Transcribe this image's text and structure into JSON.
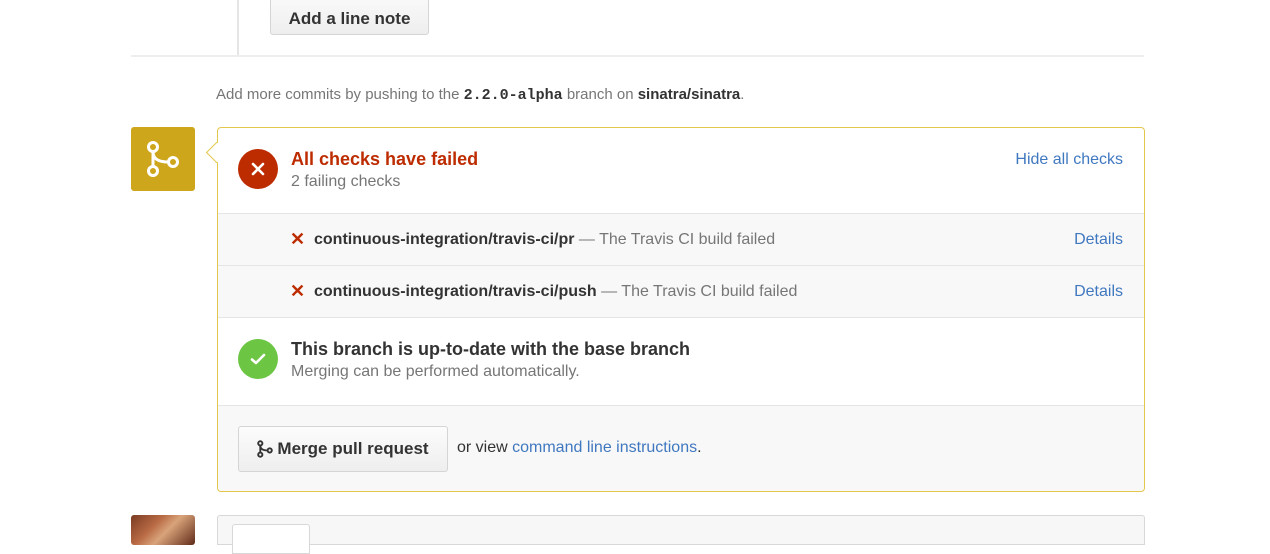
{
  "line_note": {
    "button_label": "Add a line note"
  },
  "push_note": {
    "prefix": "Add more commits by pushing to the ",
    "branch": "2.2.0-alpha",
    "middle": " branch on ",
    "repo": "sinatra/sinatra",
    "suffix": "."
  },
  "colors": {
    "warning_accent": "#cea61b",
    "fail_red": "#bd2c00",
    "success_green": "#6cc644",
    "link_blue": "#4078c0"
  },
  "checks_status": {
    "icon": "x-icon",
    "title": "All checks have failed",
    "subtitle": "2 failing checks",
    "hide_link": "Hide all checks"
  },
  "checks": [
    {
      "icon": "x-icon",
      "context": "continuous-integration/travis-ci/pr",
      "description": " — The Travis CI build failed",
      "details_label": "Details"
    },
    {
      "icon": "x-icon",
      "context": "continuous-integration/travis-ci/push",
      "description": " — The Travis CI build failed",
      "details_label": "Details"
    }
  ],
  "branch_status": {
    "icon": "check-icon",
    "title": "This branch is up-to-date with the base branch",
    "subtitle": "Merging can be performed automatically."
  },
  "merge": {
    "button_label": "Merge pull request",
    "or_view_prefix": "or view ",
    "command_line_link": "command line instructions",
    "suffix": "."
  }
}
